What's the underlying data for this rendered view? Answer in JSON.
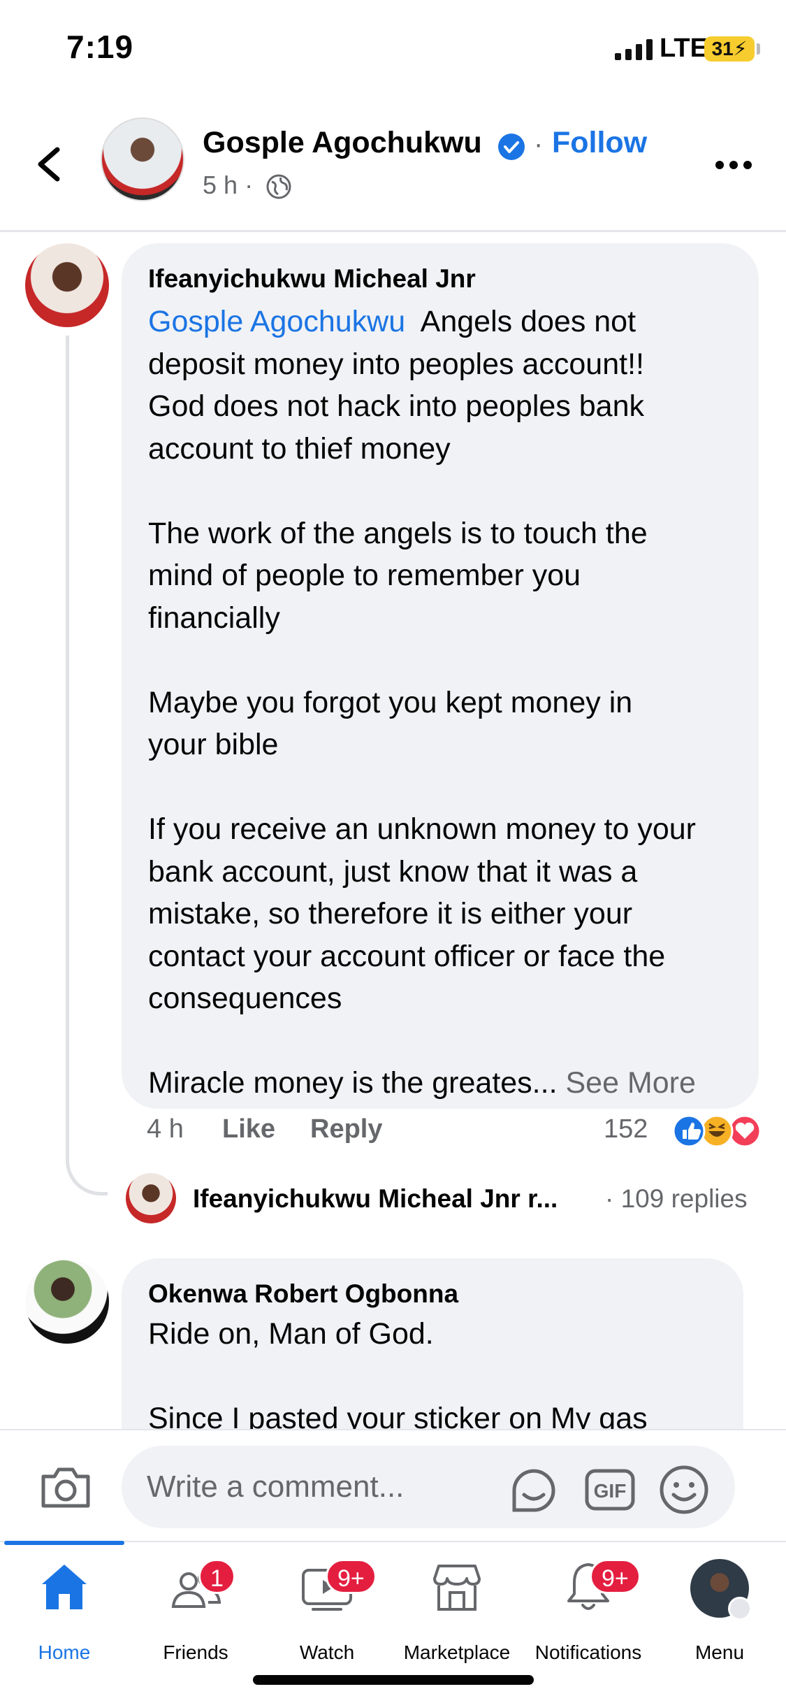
{
  "status_bar": {
    "time": "7:19",
    "network": "LTE",
    "battery": "31"
  },
  "post": {
    "author": "Gosple Agochukwu",
    "follow_label": "Follow",
    "age": "5 h",
    "separator": "·"
  },
  "comments": [
    {
      "author": "Ifeanyichukwu Micheal Jnr",
      "mention": "Gosple Agochukwu",
      "text": "  Angels does not\ndeposit money into peoples account!!\nGod does not hack into peoples bank\naccount to thief money\n\nThe work of the angels is to touch the\nmind of people to remember you\nfinancially\n\nMaybe you forgot you kept money in\nyour bible\n\nIf you receive an unknown money to your\nbank account, just know that it was a\nmistake, so therefore it is either your\ncontact your account officer or face the\nconsequences\n\nMiracle money is the greates... ",
      "see_more": "See More",
      "time": "4 h",
      "like_label": "Like",
      "reply_label": "Reply",
      "reaction_count": "152",
      "reactions": [
        "like-icon",
        "haha-icon",
        "love-icon"
      ],
      "reply_preview": {
        "name": "Ifeanyichukwu Micheal Jnr r...",
        "count": "· 109 replies"
      }
    },
    {
      "author": "Okenwa Robert Ogbonna",
      "text": "Ride on, Man of God.\n\nSince I pasted your sticker on My gas"
    }
  ],
  "composer": {
    "placeholder": "Write a comment...",
    "gif_label": "GIF"
  },
  "tabs": [
    {
      "label": "Home",
      "icon": "home-icon",
      "active": true
    },
    {
      "label": "Friends",
      "icon": "friends-icon",
      "badge": "1"
    },
    {
      "label": "Watch",
      "icon": "watch-icon",
      "badge": "9+"
    },
    {
      "label": "Marketplace",
      "icon": "marketplace-icon"
    },
    {
      "label": "Notifications",
      "icon": "bell-icon",
      "badge": "9+"
    },
    {
      "label": "Menu",
      "icon": "menu-avatar"
    }
  ],
  "colors": {
    "accent": "#1b74e4",
    "badge": "#e41e3f",
    "bubble": "#f0f2f5",
    "battery": "#f7cc2e"
  }
}
